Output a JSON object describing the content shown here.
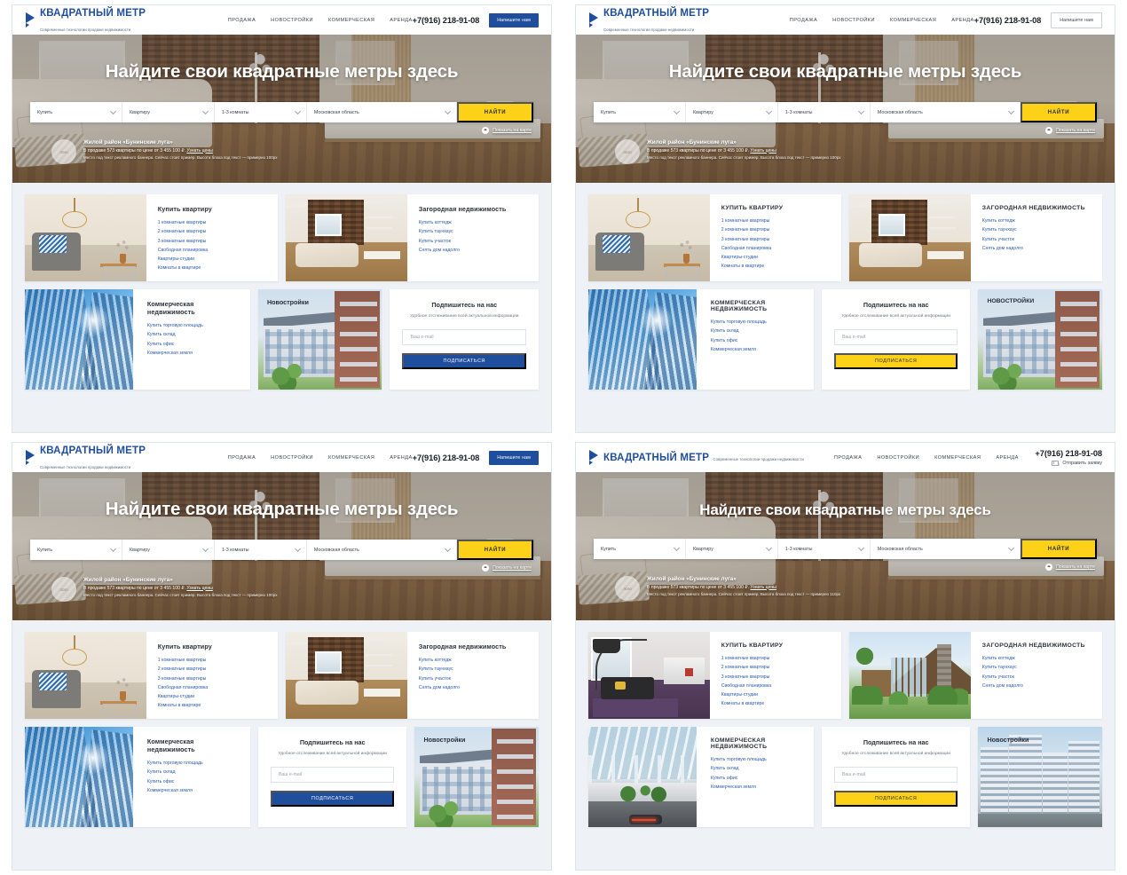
{
  "brand": {
    "title": "КВАДРАТНЫЙ МЕТР",
    "tagline": "Современные технологии продажи недвижимости",
    "accent_blue": "#1F4E9C",
    "accent_yellow": "#FCD117",
    "link_blue": "#2B5CAD",
    "page_bg": "#EEF1F5"
  },
  "nav": {
    "items": [
      {
        "label": "ПРОДАЖА"
      },
      {
        "label": "НОВОСТРОЙКИ"
      },
      {
        "label": "КОММЕРЧЕСКАЯ"
      },
      {
        "label": "АРЕНДА"
      }
    ]
  },
  "contact": {
    "phone": "+7(916) 218-91-08",
    "cta_button": "Напишите нам",
    "cta_link": "Отправить заявку"
  },
  "hero": {
    "title": "Найдите свои квадратные метры здесь",
    "search": {
      "deal": "Купить",
      "property": "Квартиру",
      "rooms": "1-3 комнаты",
      "region": "Московская область",
      "submit": "НАЙТИ"
    },
    "map_link": "Показать на карте",
    "promo": {
      "logo_text": "лого",
      "title": "Жилой район «Бунинские луга»",
      "line2_pre": "В продаже 573 квартиры по цене от 3 455 100 ₽. ",
      "line2_link": "Узнать цены",
      "line3_100": "Место под текст рекламного баннера. Сейчас стоит пример. Высота блока под текст — примерно 100рх",
      "line3_110": "Место под текст рекламного баннера. Сейчас стоит пример. Высота блока под текст — примерно 110рх"
    }
  },
  "cards": {
    "apartment": {
      "title": "Купить квартиру",
      "links": [
        "1 комнатные квартиры",
        "2 комнатные квартиры",
        "3 комнатные квартиры",
        "Свободная планировка",
        "Квартиры-студии",
        "Комнаты в квартире"
      ]
    },
    "country": {
      "title": "Загородная недвижимость",
      "links": [
        "Купить коттедж",
        "Купить таунхаус",
        "Купить участок",
        "Снять дом надолго"
      ]
    },
    "commercial": {
      "title": "Коммерческая недвижимость",
      "links": [
        "Купить торговую площадь",
        "Купить склад",
        "Купить офис",
        "Коммерческая земля"
      ]
    },
    "newbuild": {
      "title": "Новостройки"
    },
    "subscribe": {
      "title": "Подпишитесь на нас",
      "subtitle": "Удобное отслеживание всей актуальной информации",
      "email_placeholder": "Ваш e-mail",
      "button": "ПОДПИСАТЬСЯ"
    }
  },
  "variants": [
    {
      "id": "v1",
      "cta_style": "solid-blue-button",
      "heading_case": "sentence",
      "subscribe_button": "blue",
      "subscribe_position": "right",
      "banner_height": "100рх"
    },
    {
      "id": "v2",
      "cta_style": "outline-button",
      "heading_case": "uppercase",
      "subscribe_button": "yellow",
      "subscribe_position": "middle",
      "banner_height": "100рх"
    },
    {
      "id": "v3",
      "cta_style": "solid-blue-button",
      "heading_case": "sentence",
      "subscribe_button": "blue",
      "subscribe_position": "middle",
      "banner_height": "100рх"
    },
    {
      "id": "v4",
      "cta_style": "mail-link",
      "heading_case": "uppercase",
      "subscribe_button": "yellow",
      "subscribe_position": "middle",
      "banner_height": "110рх"
    }
  ]
}
